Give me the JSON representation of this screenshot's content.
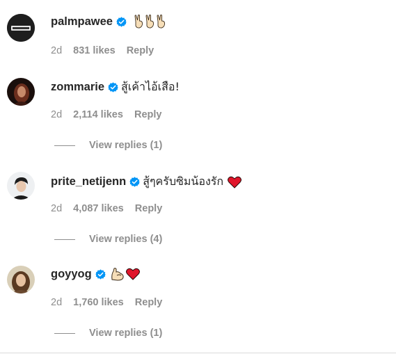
{
  "comments": [
    {
      "username": "palmpawee",
      "text": "",
      "time": "2d",
      "likes": "831 likes",
      "reply": "Reply",
      "view_replies": ""
    },
    {
      "username": "zommarie",
      "text": "สู้เค้าไอ้เสือ!",
      "time": "2d",
      "likes": "2,114 likes",
      "reply": "Reply",
      "view_replies": "View replies (1)"
    },
    {
      "username": "prite_netijenn",
      "text": "สู้ๆครับซิมน้องรัก",
      "time": "2d",
      "likes": "4,087 likes",
      "reply": "Reply",
      "view_replies": "View replies (4)"
    },
    {
      "username": "goyyog",
      "text": "",
      "time": "2d",
      "likes": "1,760 likes",
      "reply": "Reply",
      "view_replies": "View replies (1)"
    }
  ],
  "icons": {
    "verified": "verified-badge-icon",
    "victory_hands": "victory-hand-emoji-icon",
    "flexed_bicep": "flexed-bicep-emoji-icon",
    "red_heart": "red-heart-emoji-icon"
  },
  "colors": {
    "verified_blue": "#0095f6",
    "meta_gray": "#8e8e8e",
    "heart_red": "#e0162b"
  }
}
